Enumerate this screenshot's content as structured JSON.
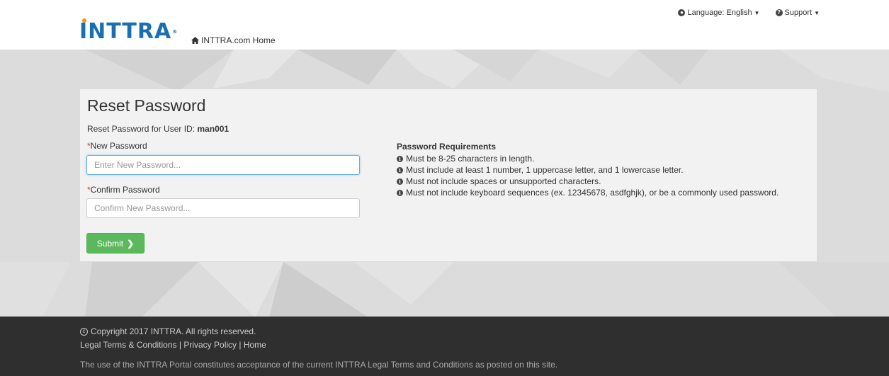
{
  "header": {
    "logo_text": "INTTRA",
    "home_link": "INTTRA.com Home",
    "language_label": "Language: English",
    "support_label": "Support"
  },
  "form": {
    "title": "Reset Password",
    "subtitle_prefix": "Reset Password for User ID:",
    "user_id": "man001",
    "new_password_label": "New Password",
    "new_password_placeholder": "Enter New Password...",
    "confirm_password_label": "Confirm Password",
    "confirm_password_placeholder": "Confirm New Password...",
    "required_marker": "*",
    "submit_label": "Submit"
  },
  "requirements": {
    "title": "Password Requirements",
    "items": [
      "Must be 8-25 characters in length.",
      "Must include at least 1 number, 1 uppercase letter, and 1 lowercase letter.",
      "Must not include spaces or unsupported characters.",
      "Must not include keyboard sequences (ex. 12345678, asdfghjk), or be a commonly used password."
    ]
  },
  "footer": {
    "copyright": "Copyright 2017 INTTRA. All rights reserved.",
    "legal_link": "Legal Terms & Conditions",
    "privacy_link": "Privacy Policy",
    "home_link": "Home",
    "separator": "|",
    "notice": "The use of the INTTRA Portal constitutes acceptance of the current INTTRA Legal Terms and Conditions as posted on this site."
  },
  "colors": {
    "brand": "#1a6fb3",
    "accent_dot": "#f7941d",
    "submit_green": "#5cb85c",
    "footer_bg": "#2f2f2f",
    "required_red": "#c0392b"
  }
}
